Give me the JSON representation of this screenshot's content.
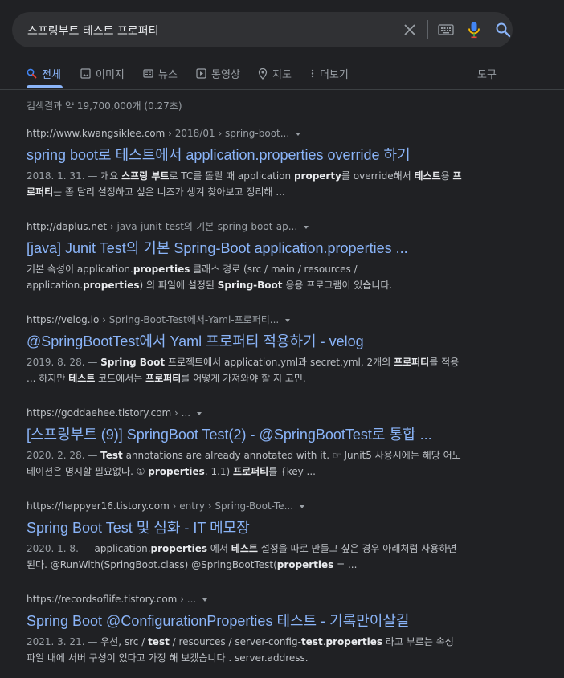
{
  "search": {
    "query": "스프링부트 테스트 프로퍼티"
  },
  "tabs": [
    {
      "label": "전체",
      "icon": "search-icon",
      "active": true
    },
    {
      "label": "이미지",
      "icon": "image-icon"
    },
    {
      "label": "뉴스",
      "icon": "news-icon"
    },
    {
      "label": "동영상",
      "icon": "video-icon"
    },
    {
      "label": "지도",
      "icon": "map-pin-icon"
    },
    {
      "label": "더보기",
      "icon": "more-vert-icon"
    },
    {
      "label": "도구"
    }
  ],
  "stats": "검색결과 약 19,700,000개 (0.27초)",
  "colors": {
    "background": "#202124",
    "searchbox": "#303134",
    "link": "#8ab4f8",
    "text": "#bdc1c6",
    "muted": "#9aa0a6",
    "mic": "#fbbc04"
  },
  "results": [
    {
      "host": "http://www.kwangsiklee.com",
      "path": " › 2018/01 › spring-boot...",
      "title": "spring boot로 테스트에서 application.properties override 하기",
      "snippet": [
        {
          "t": "2018. 1. 31. — ",
          "k": "date"
        },
        {
          "t": "개요 "
        },
        {
          "t": "스프링 부트",
          "k": "b"
        },
        {
          "t": "로 TC를 돌릴 때 application "
        },
        {
          "t": "property",
          "k": "b"
        },
        {
          "t": "를 override해서 "
        },
        {
          "t": "테스트",
          "k": "b"
        },
        {
          "t": "용 "
        },
        {
          "t": "프로퍼티",
          "k": "b"
        },
        {
          "t": "는 좀 달리 설정하고 싶은 니즈가 생겨 찾아보고 정리해 ..."
        }
      ]
    },
    {
      "host": "http://daplus.net",
      "path": " › java-junit-test의-기본-spring-boot-ap...",
      "title": "[java] Junit Test의 기본 Spring-Boot application.properties ...",
      "snippet": [
        {
          "t": "기본 속성이 application."
        },
        {
          "t": "properties",
          "k": "b"
        },
        {
          "t": " 클래스 경로 (src / main / resources / application."
        },
        {
          "t": "properties",
          "k": "b"
        },
        {
          "t": ") 의 파일에 설정된 "
        },
        {
          "t": "Spring-Boot",
          "k": "b"
        },
        {
          "t": " 응용 프로그램이 있습니다."
        }
      ]
    },
    {
      "host": "https://velog.io",
      "path": " › Spring-Boot-Test에서-Yaml-프로퍼티...",
      "title": "@SpringBootTest에서 Yaml 프로퍼티 적용하기 - velog",
      "snippet": [
        {
          "t": "2019. 8. 28. — ",
          "k": "date"
        },
        {
          "t": "Spring Boot",
          "k": "b"
        },
        {
          "t": " 프로젝트에서 application.yml과 secret.yml, 2개의 "
        },
        {
          "t": "프로퍼티",
          "k": "b"
        },
        {
          "t": "를 적용 ... 하지만 "
        },
        {
          "t": "테스트",
          "k": "b"
        },
        {
          "t": " 코드에서는 "
        },
        {
          "t": "프로퍼티",
          "k": "b"
        },
        {
          "t": "를 어떻게 가져와야 할 지 고민."
        }
      ]
    },
    {
      "host": "https://goddaehee.tistory.com",
      "path": " › ...",
      "title": "[스프링부트 (9)] SpringBoot Test(2) - @SpringBootTest로 통합 ...",
      "snippet": [
        {
          "t": "2020. 2. 28. — ",
          "k": "date"
        },
        {
          "t": "Test",
          "k": "b"
        },
        {
          "t": " annotations are already annotated with it. ☞ Junit5 사용시에는 해당 어노테이션은 명시할 필요없다. ① "
        },
        {
          "t": "properties",
          "k": "b"
        },
        {
          "t": ". 1.1) "
        },
        {
          "t": "프로퍼티",
          "k": "b"
        },
        {
          "t": "를 {key ..."
        }
      ]
    },
    {
      "host": "https://happyer16.tistory.com",
      "path": " › entry › Spring-Boot-Te...",
      "title": "Spring Boot Test 및 심화 - IT 메모장",
      "snippet": [
        {
          "t": "2020. 1. 8. — ",
          "k": "date"
        },
        {
          "t": "application."
        },
        {
          "t": "properties",
          "k": "b"
        },
        {
          "t": " 에서 "
        },
        {
          "t": "테스트",
          "k": "b"
        },
        {
          "t": " 설정을 따로 만들고 싶은 경우 아래처럼 사용하면 된다. @RunWith(SpringBoot.class) @SpringBootTest("
        },
        {
          "t": "properties",
          "k": "b"
        },
        {
          "t": " = ..."
        }
      ]
    },
    {
      "host": "https://recordsoflife.tistory.com",
      "path": " › ...",
      "title": "Spring Boot @ConfigurationProperties 테스트 - 기록만이살길",
      "snippet": [
        {
          "t": "2021. 3. 21. — ",
          "k": "date"
        },
        {
          "t": "우선, src / "
        },
        {
          "t": "test",
          "k": "b"
        },
        {
          "t": " / resources / server-config-"
        },
        {
          "t": "test",
          "k": "b"
        },
        {
          "t": "."
        },
        {
          "t": "properties",
          "k": "b"
        },
        {
          "t": " 라고 부르는 속성 파일 내에 서버 구성이 있다고 가정 해 보겠습니다 . server.address."
        }
      ]
    }
  ]
}
